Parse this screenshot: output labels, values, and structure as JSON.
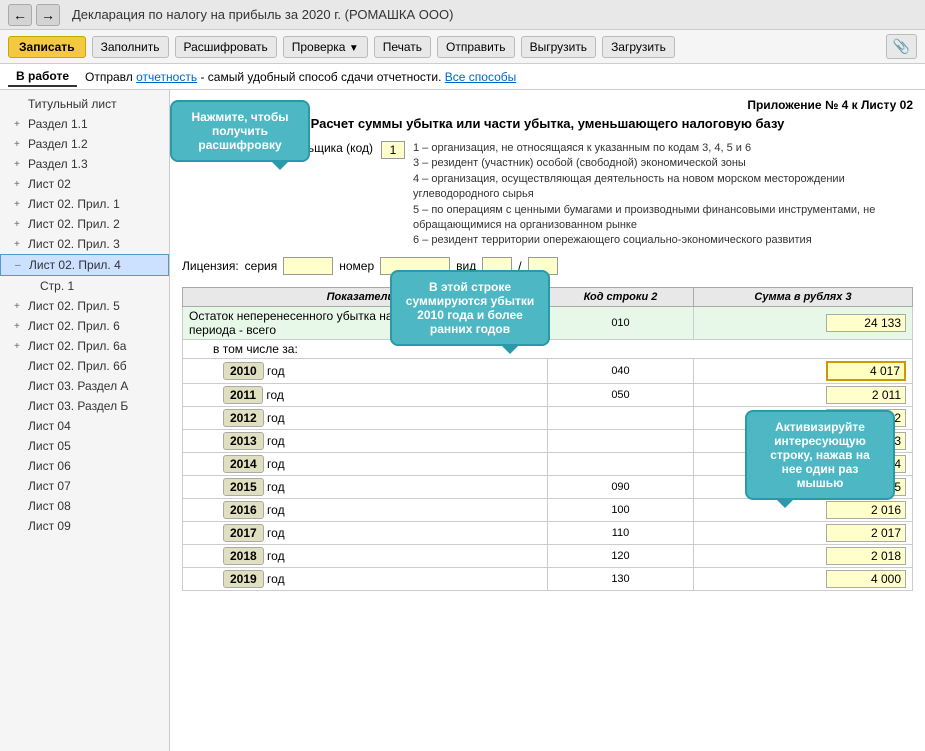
{
  "titleBar": {
    "title": "Декларация по налогу на прибыль за 2020 г. (РОМАШКА ООО)"
  },
  "toolbar": {
    "zapisat": "Записать",
    "zapolnit": "Заполнить",
    "rasshifrovat": "Расшифровать",
    "proverka": "Проверка",
    "pechat": "Печать",
    "otpravit": "Отправить",
    "vygruzit": "Выгрузить",
    "zagruzit": "Загрузить"
  },
  "statusBar": {
    "tab": "В работе",
    "otprav": "Отправл",
    "linkText": "отчетность",
    "linkDesc": " - самый удобный способ сдачи отчетности.",
    "allWays": "Все способы"
  },
  "sidebar": {
    "items": [
      {
        "id": "titulny",
        "label": "Титульный лист",
        "indent": 1,
        "expand": "none"
      },
      {
        "id": "razdel11",
        "label": "Раздел 1.1",
        "indent": 1,
        "expand": "plus"
      },
      {
        "id": "razdel12",
        "label": "Раздел 1.2",
        "indent": 1,
        "expand": "plus"
      },
      {
        "id": "razdel13",
        "label": "Раздел 1.3",
        "indent": 1,
        "expand": "plus"
      },
      {
        "id": "list02",
        "label": "Лист 02",
        "indent": 1,
        "expand": "plus"
      },
      {
        "id": "list02pril1",
        "label": "Лист 02. Прил. 1",
        "indent": 1,
        "expand": "plus"
      },
      {
        "id": "list02pril2",
        "label": "Лист 02. Прил. 2",
        "indent": 1,
        "expand": "plus"
      },
      {
        "id": "list02pril3",
        "label": "Лист 02. Прил. 3",
        "indent": 1,
        "expand": "plus"
      },
      {
        "id": "list02pril4",
        "label": "Лист 02. Прил. 4",
        "indent": 1,
        "expand": "minus",
        "active": true
      },
      {
        "id": "str1",
        "label": "Стр. 1",
        "indent": 2,
        "expand": "none",
        "child": true
      },
      {
        "id": "list02pril5",
        "label": "Лист 02. Прил. 5",
        "indent": 1,
        "expand": "plus"
      },
      {
        "id": "list02pril6",
        "label": "Лист 02. Прил. 6",
        "indent": 1,
        "expand": "plus"
      },
      {
        "id": "list02pril6a",
        "label": "Лист 02. Прил. 6а",
        "indent": 1,
        "expand": "plus"
      },
      {
        "id": "list02pril6b",
        "label": "Лист 02. Прил. 6б",
        "indent": 1,
        "expand": "none"
      },
      {
        "id": "list03razdelA",
        "label": "Лист 03. Раздел А",
        "indent": 1,
        "expand": "none"
      },
      {
        "id": "list03razdelB",
        "label": "Лист 03. Раздел Б",
        "indent": 1,
        "expand": "none"
      },
      {
        "id": "list04",
        "label": "Лист 04",
        "indent": 1,
        "expand": "none"
      },
      {
        "id": "list05",
        "label": "Лист 05",
        "indent": 1,
        "expand": "none"
      },
      {
        "id": "list06",
        "label": "Лист 06",
        "indent": 1,
        "expand": "none"
      },
      {
        "id": "list07",
        "label": "Лист 07",
        "indent": 1,
        "expand": "none"
      },
      {
        "id": "list08",
        "label": "Лист 08",
        "indent": 1,
        "expand": "none"
      },
      {
        "id": "list09",
        "label": "Лист 09",
        "indent": 1,
        "expand": "none"
      }
    ]
  },
  "content": {
    "appendixHeader": "Приложение № 4 к Листу 02",
    "formTitle": "Расчет суммы убытка или части убытка, уменьшающего налоговую базу",
    "priznak": {
      "label": "Признак налогоплательщика (код)",
      "value": "1",
      "descriptions": [
        "1 – организация, не относящаяся к указанным по кодам 3, 4, 5 и 6",
        "3 – резидент (участник) особой (свободной) экономической зоны",
        "4 – организация, осуществляющая деятельность на новом морском месторождении углеводородного сырья",
        "5 – по операциям с ценными бумагами и производными финансовыми инструментами, не обращающимися на организованном рынке",
        "6 – резидент территории опережающего социально-экономического развития"
      ]
    },
    "licenziya": {
      "label": "Лицензия:",
      "seriya": "серия",
      "nomer": "номер",
      "vid": "вид"
    },
    "tableHeaders": {
      "col1": "Показатели 1",
      "col2": "Код строки 2",
      "col3": "Сумма в рублях 3"
    },
    "mainRow": {
      "label": "Остаток неперенесенного убытка на начало налогового периода - всего",
      "code": "010",
      "value": "24 133"
    },
    "subLabel": "в том числе за:",
    "years": [
      {
        "year": "2010",
        "code": "040",
        "value": "4 017",
        "highlighted": true
      },
      {
        "year": "2011",
        "code": "050",
        "value": "2 011"
      },
      {
        "year": "2012",
        "code": "",
        "value": "2 012"
      },
      {
        "year": "2013",
        "code": "",
        "value": "2 013"
      },
      {
        "year": "2014",
        "code": "",
        "value": "2 014"
      },
      {
        "year": "2015",
        "code": "090",
        "value": "2 015"
      },
      {
        "year": "2016",
        "code": "100",
        "value": "2 016"
      },
      {
        "year": "2017",
        "code": "110",
        "value": "2 017"
      },
      {
        "year": "2018",
        "code": "120",
        "value": "2 018"
      },
      {
        "year": "2019",
        "code": "130",
        "value": "4 000"
      }
    ]
  },
  "tooltips": {
    "tooltip1": "Нажмите, чтобы получить расшифровку",
    "tooltip2": "В этой строке суммируются убытки 2010 года и более ранних годов",
    "tooltip3": "Активизируйте интересующую строку, нажав на нее один раз мышью"
  }
}
